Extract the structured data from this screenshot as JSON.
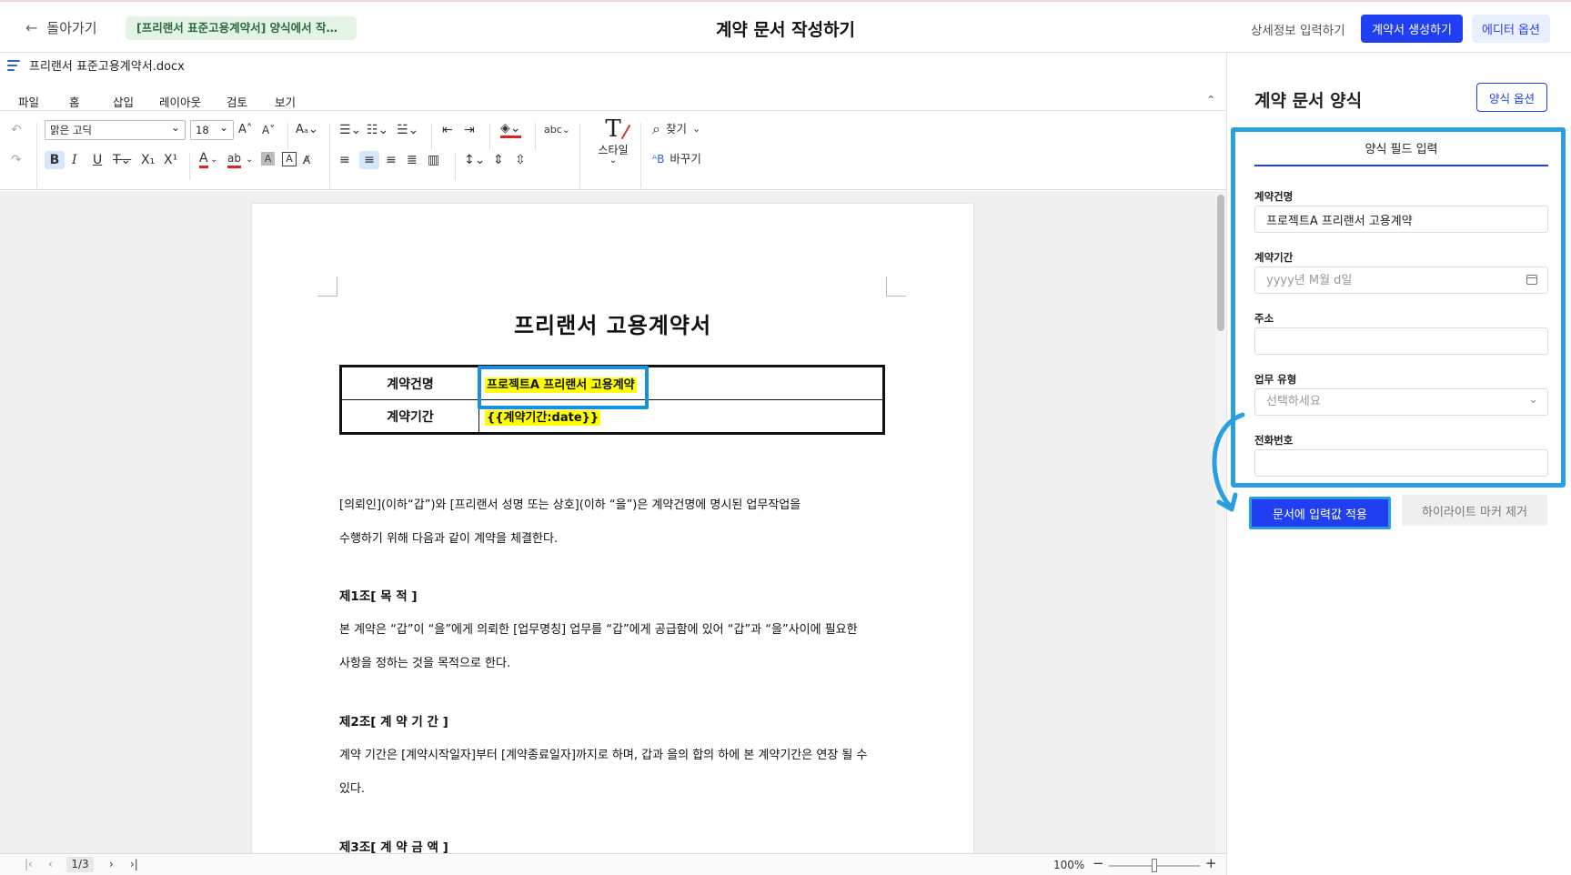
{
  "header": {
    "back_label": "돌아가기",
    "status_badge": "[프리랜서 표준고용계약서] 양식에서 작성중...",
    "title": "계약 문서 작성하기",
    "detail_link": "상세정보 입력하기",
    "generate_button": "계약서 생성하기",
    "editor_options_button": "에디터 옵션"
  },
  "editor": {
    "filename": "프리랜서 표준고용계약서.docx",
    "menus": [
      "파일",
      "홈",
      "삽입",
      "레이아웃",
      "검토",
      "보기"
    ],
    "active_menu": "홈",
    "font_name": "맑은 고딕",
    "font_size": "18",
    "style_label": "스타일",
    "find_label": "찾기",
    "replace_label": "바꾸기",
    "page_indicator": "1/3",
    "zoom": "100%"
  },
  "document": {
    "title": "프리랜서 고용계약서",
    "table": [
      {
        "label": "계약건명",
        "value": "프로젝트A 프리랜서 고용계약"
      },
      {
        "label": "계약기간",
        "value": "{{계약기간:date}}"
      }
    ],
    "paragraphs": {
      "intro1": "[의뢰인](이하“갑”)와 [프리랜서 성명 또는 상호](이하 “을”)은 계약건명에 명시된 업무작업을",
      "intro2": "수행하기 위해 다음과 같이 계약을 체결한다.",
      "art1_head": "제1조[ 목 적 ]",
      "art1_p1": "본 계약은 “갑”이 “을”에게 의뢰한 [업무명칭] 업무를 “갑”에게 공급함에 있어 “갑”과 “을”사이에 필요한",
      "art1_p2": "사항을 정하는 것을 목적으로 한다.",
      "art2_head": "제2조[ 계 약 기 간 ]",
      "art2_p1": "계약 기간은 [계약시작일자]부터 [계약종료일자]까지로 하며, 갑과 을의 합의 하에 본 계약기간은 연장 될 수",
      "art2_p2": "있다.",
      "art3_head": "제3조[ 계 약 금 액 ]"
    }
  },
  "panel": {
    "title": "계약 문서 양식",
    "options_button": "양식 옵션",
    "tab": "양식 필드 입력",
    "fields": {
      "name_label": "계약건명",
      "name_value": "프로젝트A 프리랜서 고용계약",
      "period_label": "계약기간",
      "period_placeholder": "yyyy년 M월 d일",
      "address_label": "주소",
      "type_label": "업무 유형",
      "type_placeholder": "선택하세요",
      "phone_label": "전화번호"
    },
    "apply_button": "문서에 입력값 적용",
    "remove_button": "하이라이트 마커 제거"
  },
  "colors": {
    "primary": "#1f3ff0",
    "highlight_box": "#2a9fe0",
    "marker": "#ffff00",
    "status_bg": "#e3f4e6"
  }
}
